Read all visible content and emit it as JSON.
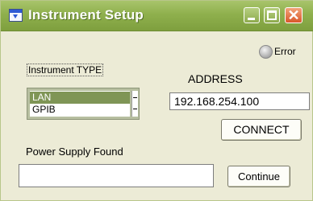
{
  "window": {
    "title": "Instrument Setup",
    "app_icon": "window-app-icon",
    "controls": [
      "minimize-icon",
      "maximize-icon",
      "close-icon"
    ]
  },
  "status": {
    "indicator_label": "Error",
    "indicator_icon": "led-indicator-icon",
    "indicator_state": "off"
  },
  "instrument_type": {
    "label": "Instrument TYPE",
    "options": [
      "LAN",
      "GPIB"
    ],
    "selected": "LAN"
  },
  "address": {
    "label": "ADDRESS",
    "value": "192.168.254.100"
  },
  "buttons": {
    "connect": "CONNECT",
    "continue": "Continue"
  },
  "power_supply": {
    "label": "Power Supply  Found",
    "value": ""
  },
  "colors": {
    "titlebar": "#8fb04d",
    "window_bg": "#ecebd6",
    "selection": "#7f9556",
    "close_button": "#d9572a"
  }
}
